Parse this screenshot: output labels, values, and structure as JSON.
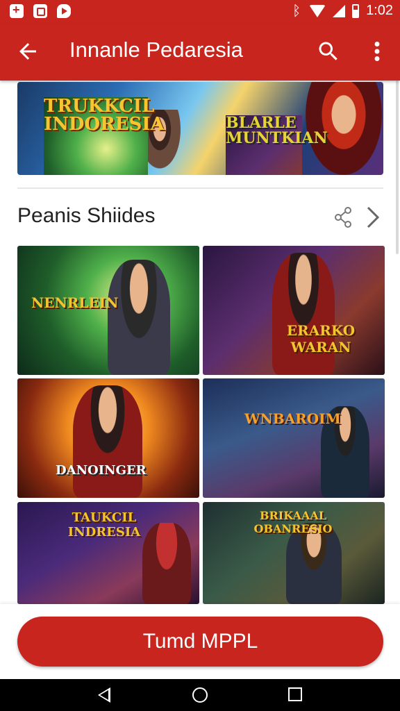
{
  "status_bar": {
    "time": "1:02",
    "icons": [
      "notification-plus-icon",
      "gallery-icon",
      "youtube-icon",
      "bluetooth-icon",
      "wifi-icon",
      "signal-icon",
      "battery-icon"
    ]
  },
  "app_bar": {
    "title": "Innanle Pedaresia",
    "icons": [
      "back-arrow-icon",
      "search-icon",
      "more-vert-icon"
    ]
  },
  "banner": {
    "text_left": "TRUKKCIL INDORESIA",
    "text_right": "BLARLE MUNTKIAN"
  },
  "section": {
    "title": "Peanis Shiides",
    "icons": [
      "share-icon",
      "chevron-right-icon"
    ]
  },
  "tiles": [
    {
      "label": "NENRLEIN"
    },
    {
      "label": "ERARKO WARAN"
    },
    {
      "label": "DANOINGER"
    },
    {
      "label": "WNBAROIM"
    },
    {
      "label": "TAUKCIL INDRESIA"
    },
    {
      "label": "BRIKAAAL OBANRESIO"
    }
  ],
  "cta": {
    "label": "Tumd MPPL"
  },
  "colors": {
    "primary": "#c9251f",
    "background": "#ffffff"
  }
}
